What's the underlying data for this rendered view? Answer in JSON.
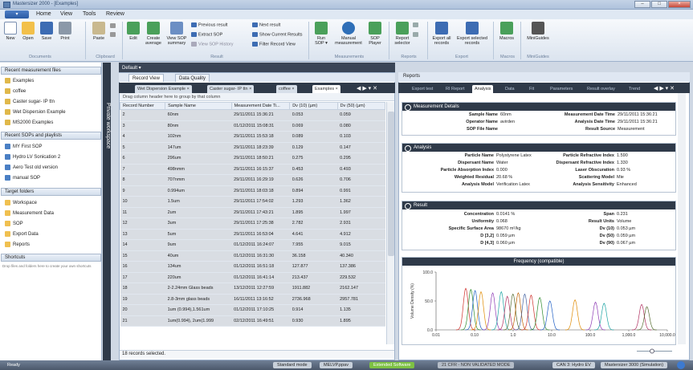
{
  "window": {
    "title": "Mastersizer 2000 - [Examples]",
    "controls": [
      "–",
      "□",
      "×"
    ]
  },
  "menu": {
    "file_label": "▾",
    "items": [
      "Home",
      "View",
      "Tools",
      "Review"
    ]
  },
  "ribbon": {
    "documents": {
      "label": "Documents",
      "new": "New",
      "open": "Open",
      "save": "Save",
      "print": "Print"
    },
    "clipboard": {
      "label": "Clipboard",
      "paste": "Paste"
    },
    "result": {
      "label": "Result",
      "edit": "Edit",
      "create_average": "Create average",
      "view_sop_summary": "View SOP summary",
      "previous_result": "Previous result",
      "extract_sop": "Extract SOP",
      "view_sop_history": "View SOP History",
      "next_result": "Next result",
      "show_current_results": "Show Current Results",
      "filter_record_view": "Filter Record View"
    },
    "measurements": {
      "label": "Measurements",
      "run_sop": "Run SOP ▾",
      "manual_measurement": "Manual measurement",
      "sop_player": "SOP Player"
    },
    "reports": {
      "label": "Reports",
      "report_selector": "Report selector"
    },
    "export": {
      "label": "Export",
      "export_all": "Export all records",
      "export_selected": "Export selected records"
    },
    "macros": {
      "label": "Macros",
      "macros": "Macros"
    },
    "miniguides": {
      "label": "MiniGuides",
      "miniguides": "MiniGuides"
    }
  },
  "left": {
    "recent_files_header": "Recent measurement files",
    "recent_files": [
      "Examples",
      "coffee",
      "Caster sugar- IP ttn",
      "Wet Dispersion Example",
      "MS2000 Examples"
    ],
    "recent_sops_header": "Recent SOPs and playlists",
    "recent_sops": [
      "MY First SOP",
      "Hydro LV Sonication 2",
      "Aero Test old version",
      "manual SOP"
    ],
    "target_header": "Target folders",
    "targets": [
      "Workspace",
      "Measurement Data",
      "SOP",
      "Export Data",
      "Reports"
    ],
    "shortcuts_header": "Shortcuts",
    "shortcuts_hint": "Drop files and folders here to create your own shortcuts",
    "private_workspace": "Private workspace"
  },
  "center": {
    "default_label": "Default ▾",
    "view_tabs": [
      "Record View",
      "Data Quality"
    ],
    "doc_tabs": [
      "Wet Dispersion Example ×",
      "Caster sugar- IP ttn ×",
      "coffee ×",
      "Examples ×"
    ],
    "group_by_hint": "Drag column header here to group by that column",
    "columns": [
      "Record Number",
      "Sample Name",
      "Measurement Date Ti...",
      "Dv (10) (µm)",
      "Dv (50) (µm)"
    ],
    "rows": [
      [
        "2",
        "60nm",
        "29/11/2011 15:36:21",
        "0.053",
        "0.059"
      ],
      [
        "3",
        "80nm",
        "01/12/2011 15:08:31",
        "0.069",
        "0.080"
      ],
      [
        "4",
        "102nm",
        "29/11/2011 15:53:18",
        "0.089",
        "0.103"
      ],
      [
        "5",
        "147um",
        "29/11/2011 18:23:39",
        "0.129",
        "0.147"
      ],
      [
        "6",
        "296um",
        "29/11/2011 18:50:21",
        "0.275",
        "0.295"
      ],
      [
        "7",
        "498nmm",
        "29/11/2011 16:15:37",
        "0.453",
        "0.493"
      ],
      [
        "8",
        "707nmm",
        "29/11/2011 16:29:19",
        "0.626",
        "0.706"
      ],
      [
        "9",
        "0.994um",
        "29/11/2011 18:03:18",
        "0.894",
        "0.991"
      ],
      [
        "10",
        "1.5um",
        "29/11/2011 17:54:02",
        "1.293",
        "1.362"
      ],
      [
        "11",
        "2um",
        "29/11/2011 17:43:21",
        "1.895",
        "1.997"
      ],
      [
        "12",
        "3um",
        "29/11/2011 17:25:38",
        "2.782",
        "2.931"
      ],
      [
        "13",
        "5um",
        "29/11/2011 16:53:04",
        "4.641",
        "4.912"
      ],
      [
        "14",
        "9um",
        "01/12/2011 16:24:07",
        "7.955",
        "9.015"
      ],
      [
        "15",
        "40um",
        "01/12/2011 16:31:30",
        "36.158",
        "40.340"
      ],
      [
        "16",
        "134um",
        "01/12/2011 16:51:18",
        "127.877",
        "137.386"
      ],
      [
        "17",
        "220um",
        "01/12/2011 16:41:14",
        "213.437",
        "229.532"
      ],
      [
        "18",
        "2-2.24mm Glass beads",
        "13/12/2011 12:27:59",
        "1911.882",
        "2162.147"
      ],
      [
        "19",
        "2.8-3mm glass beads",
        "16/11/2011 13:16:52",
        "2736.968",
        "2957.781"
      ],
      [
        "20",
        "1um (0.994),1.561um",
        "01/12/2011 17:10:25",
        "0.914",
        "1.135"
      ],
      [
        "21",
        "1um(0.994), 2um(1.999",
        "02/12/2011 16:49:51",
        "0.930",
        "1.895"
      ]
    ],
    "selected_count": "18 records selected."
  },
  "right": {
    "header": "Reports",
    "tabs": [
      "Export test",
      "RI Report",
      "Analysis",
      "Data",
      "Fit",
      "Parameters",
      "Result overlay",
      "Trend"
    ],
    "measurement_details": {
      "title": "Measurement Details",
      "sample_name_label": "Sample Name",
      "sample_name": "60nm",
      "operator_label": "Operator Name",
      "operator": "avirden",
      "sop_label": "SOP File Name",
      "sop": "",
      "mdate_label": "Measurement Date Time",
      "mdate": "29/11/2011 15:36:21",
      "adate_label": "Analysis Date Time",
      "adate": "29/11/2011 15:36:21",
      "source_label": "Result Source",
      "source": "Measurement"
    },
    "analysis": {
      "title": "Analysis",
      "particle_name_label": "Particle Name",
      "particle_name": "Polystyrene Latex",
      "dispersant_name_label": "Dispersant Name",
      "dispersant_name": "Water",
      "abs_index_label": "Particle Absorption Index",
      "abs_index": "0.000",
      "wres_label": "Weighted Residual",
      "wres": "20.68 %",
      "model_label": "Analysis Model",
      "model": "Verification Latex",
      "pri_label": "Particle Refractive Index",
      "pri": "1.590",
      "dri_label": "Dispersant Refractive Index",
      "dri": "1.330",
      "obs_label": "Laser Obscuration",
      "obs": "0.93 %",
      "scat_label": "Scattering Model",
      "scat": "Mie",
      "sens_label": "Analysis Sensitivity",
      "sens": "Enhanced"
    },
    "result": {
      "title": "Result",
      "conc_label": "Concentration",
      "conc": "0.0141 %",
      "unif_label": "Uniformity",
      "unif": "0.068",
      "ssa_label": "Specific Surface Area",
      "ssa": "98670 m²/kg",
      "d32_label": "D [3,2]",
      "d32": "0.059 µm",
      "d43_label": "D [4,3]",
      "d43": "0.060 µm",
      "span_label": "Span",
      "span": "0.231",
      "units_label": "Result Units",
      "units": "Volume",
      "dv10_label": "Dv (10)",
      "dv10": "0.053 µm",
      "dv50_label": "Dv (50)",
      "dv50": "0.059 µm",
      "dv90_label": "Dv (90)",
      "dv90": "0.067 µm"
    }
  },
  "chart_data": {
    "type": "line",
    "title": "Frequency (compatible)",
    "xlabel": "",
    "ylabel": "Volume Density (%)",
    "xscale": "log",
    "xlim": [
      0.01,
      10000
    ],
    "ylim": [
      0,
      100
    ],
    "xticks": [
      "0.01",
      "0.10",
      "1.0",
      "10.0",
      "100.0",
      "1,000.0",
      "10,000.0"
    ],
    "yticks": [
      "0.0",
      "50.0",
      "100.0"
    ],
    "series_colors": [
      "#d0312d",
      "#2e8b2e",
      "#1f5fc4",
      "#e08a00",
      "#8e3bb5",
      "#1aa3a3",
      "#b03060",
      "#556b2f",
      "#c06000",
      "#4060a0"
    ],
    "peaks": [
      {
        "x": 0.059,
        "y": 72
      },
      {
        "x": 0.08,
        "y": 70
      },
      {
        "x": 0.103,
        "y": 68
      },
      {
        "x": 0.147,
        "y": 66
      },
      {
        "x": 0.295,
        "y": 64
      },
      {
        "x": 0.493,
        "y": 66
      },
      {
        "x": 0.706,
        "y": 58
      },
      {
        "x": 0.991,
        "y": 62
      },
      {
        "x": 1.36,
        "y": 64
      },
      {
        "x": 2.0,
        "y": 62
      },
      {
        "x": 2.93,
        "y": 60
      },
      {
        "x": 4.91,
        "y": 56
      },
      {
        "x": 9.0,
        "y": 50
      },
      {
        "x": 40.3,
        "y": 52
      },
      {
        "x": 137,
        "y": 48
      },
      {
        "x": 229,
        "y": 46
      },
      {
        "x": 2162,
        "y": 44
      },
      {
        "x": 2958,
        "y": 40
      }
    ]
  },
  "status": {
    "ready": "Ready",
    "standard_mode": "Standard mode",
    "user": "MELVP.ppav",
    "extended": "Extended Software",
    "cfr": "21 CFR - NON VALIDATED MODE",
    "can": "CAN 3: Hydro EV",
    "instrument": "Mastersizer 3000 (Simulation)"
  }
}
